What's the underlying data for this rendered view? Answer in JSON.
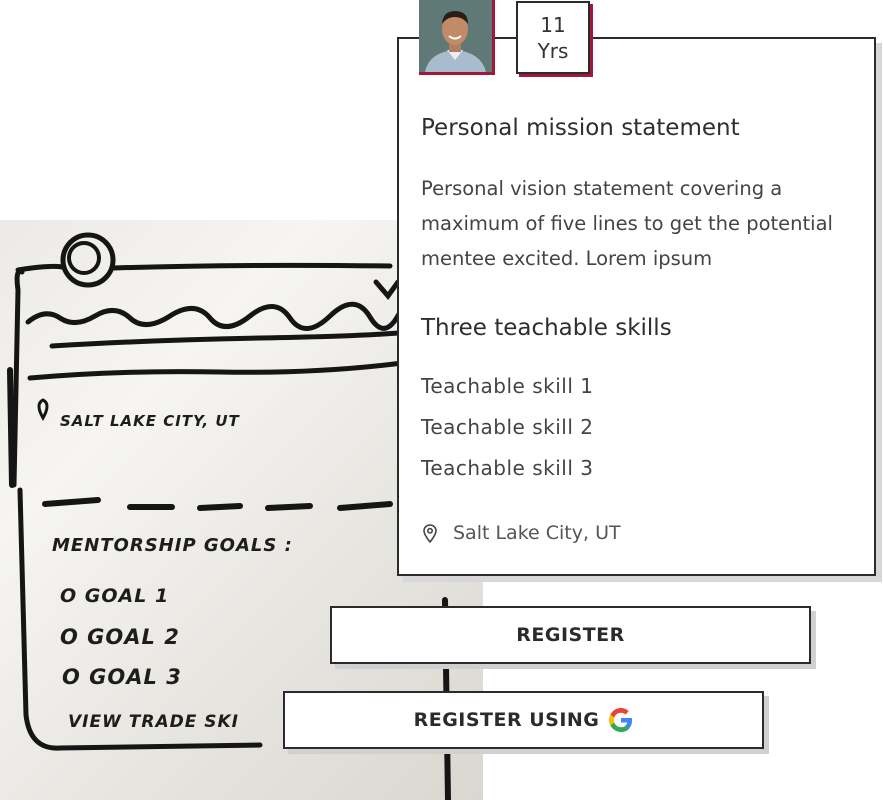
{
  "sketch": {
    "location_text": "SALT LAKE CITY, UT",
    "goals_heading": "MENTORSHIP GOALS :",
    "goals": [
      "O GOAL 1",
      "O GOAL 2",
      "O GOAL 3"
    ],
    "footer_text": "VIEW TRADE SKI"
  },
  "profile": {
    "years_value": "11",
    "years_unit": "Yrs",
    "mission_heading": "Personal mission statement",
    "mission_text": "Personal vision statement covering a maximum of five lines to get the potential mentee excited. Lorem ipsum",
    "skills_heading": "Three teachable skills",
    "skills": [
      "Teachable skill 1",
      "Teachable skill 2",
      "Teachable skill 3"
    ],
    "location": "Salt Lake City, UT",
    "location_icon": "map-pin-icon"
  },
  "actions": {
    "register_label": "REGISTER",
    "register_google_label": "REGISTER USING",
    "google_icon": "google-icon"
  },
  "colors": {
    "accent": "#a3163a",
    "border": "#2b2b2b",
    "google_blue": "#4285F4",
    "google_red": "#EA4335",
    "google_yellow": "#FBBC05",
    "google_green": "#34A853"
  }
}
